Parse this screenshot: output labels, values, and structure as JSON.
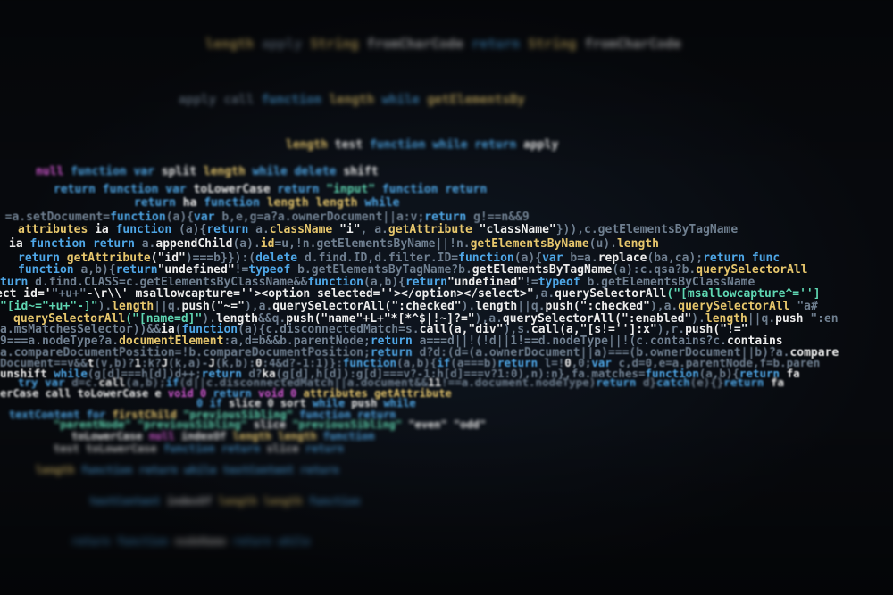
{
  "colors": {
    "b": "#4ea6e6",
    "y": "#e6c66c",
    "w": "#ececec",
    "g": "#5fd6b2",
    "d": "#6f7f90",
    "m": "#d65ad6",
    "t": "#34b6a6"
  },
  "lines": [
    [
      [
        "length ",
        "y"
      ],
      [
        "apply ",
        "d"
      ],
      [
        "String ",
        "y"
      ],
      [
        "fromCharCode ",
        "w"
      ],
      [
        "return ",
        "b"
      ],
      [
        "String ",
        "y"
      ],
      [
        "fromCharCode",
        "w"
      ]
    ],
    [
      [
        "apply ",
        "d"
      ],
      [
        "call ",
        "d"
      ],
      [
        "function ",
        "b"
      ],
      [
        "length ",
        "y"
      ],
      [
        "while ",
        "b"
      ],
      [
        "getElementsBy",
        "y"
      ]
    ],
    [
      [
        "length ",
        "y"
      ],
      [
        "test ",
        "w"
      ],
      [
        "function ",
        "b"
      ],
      [
        "while ",
        "b"
      ],
      [
        "return ",
        "b"
      ],
      [
        "apply",
        "w"
      ]
    ],
    [
      [
        "null ",
        "m"
      ],
      [
        "function ",
        "b"
      ],
      [
        "var ",
        "b"
      ],
      [
        "split ",
        "w"
      ],
      [
        "length ",
        "y"
      ],
      [
        "while ",
        "b"
      ],
      [
        "delete ",
        "b"
      ],
      [
        "shift",
        "w"
      ]
    ],
    [
      [
        "return ",
        "b"
      ],
      [
        "function ",
        "b"
      ],
      [
        "var ",
        "b"
      ],
      [
        "toLowerCase ",
        "w"
      ],
      [
        "return ",
        "b"
      ],
      [
        "\"input\" ",
        "g"
      ],
      [
        "function ",
        "b"
      ],
      [
        "return",
        "b"
      ]
    ],
    [
      [
        "return ",
        "b"
      ],
      [
        "ha ",
        "w"
      ],
      [
        "function ",
        "b"
      ],
      [
        "length ",
        "y"
      ],
      [
        "length ",
        "y"
      ],
      [
        "while",
        "b"
      ]
    ],
    [
      [
        "1 ",
        "b"
      ],
      [
        "=a.setDocument=",
        "d"
      ],
      [
        "function",
        "b"
      ],
      [
        "(a){",
        "d"
      ],
      [
        "var ",
        "b"
      ],
      [
        "b,e,g=a?a.ownerDocument||a:v;",
        "d"
      ],
      [
        "return ",
        "b"
      ],
      [
        "g!==n&&9",
        "d"
      ]
    ],
    [
      [
        "attributes ",
        "y"
      ],
      [
        "ia ",
        "w"
      ],
      [
        "function ",
        "b"
      ],
      [
        "(a){",
        "d"
      ],
      [
        "return ",
        "b"
      ],
      [
        "a.",
        "d"
      ],
      [
        "className ",
        "y"
      ],
      [
        "\"i\"",
        "w"
      ],
      [
        ", a.",
        "d"
      ],
      [
        "getAttribute ",
        "y"
      ],
      [
        "\"className\"",
        "w"
      ],
      [
        "})),c.getElementsByTagName",
        "d"
      ]
    ],
    [
      [
        "ia ",
        "w"
      ],
      [
        "function ",
        "b"
      ],
      [
        "return ",
        "b"
      ],
      [
        "a.",
        "d"
      ],
      [
        "appendChild",
        "w"
      ],
      [
        "(a).",
        "d"
      ],
      [
        "id",
        "y"
      ],
      [
        "=u,!n.getElementsByName||!n.",
        "d"
      ],
      [
        "getElementsByName",
        "y"
      ],
      [
        "(u).",
        "d"
      ],
      [
        "length",
        "y"
      ]
    ],
    [
      [
        "return ",
        "b"
      ],
      [
        "getAttribute",
        "y"
      ],
      [
        "(\"id\"",
        "w"
      ],
      [
        ")===b}}):(",
        "d"
      ],
      [
        "delete ",
        "b"
      ],
      [
        "d.find.ID,d.filter.ID=",
        "d"
      ],
      [
        "function",
        "b"
      ],
      [
        "(a){",
        "d"
      ],
      [
        "var ",
        "b"
      ],
      [
        "b=a.",
        "d"
      ],
      [
        "replace",
        "w"
      ],
      [
        "(ba,ca);",
        "d"
      ],
      [
        "return func",
        "b"
      ]
    ],
    [
      [
        "function ",
        "b"
      ],
      [
        "a,b){",
        "d"
      ],
      [
        "return",
        "b"
      ],
      [
        "\"undefined\"",
        "w"
      ],
      [
        "!=",
        "d"
      ],
      [
        "typeof ",
        "b"
      ],
      [
        "b.getElementsByTagName?b.",
        "d"
      ],
      [
        "getElementsByTagName",
        "w"
      ],
      [
        "(a):c.qsa?b.",
        "d"
      ],
      [
        "querySelectorAll",
        "y"
      ]
    ],
    [
      [
        "turn ",
        "b"
      ],
      [
        "d.find.CLASS=c.getElementsByClassName&&",
        "d"
      ],
      [
        "function",
        "b"
      ],
      [
        "(a,b){",
        "d"
      ],
      [
        "return",
        "b"
      ],
      [
        "\"undefined\"",
        "w"
      ],
      [
        "!=",
        "d"
      ],
      [
        "typeof ",
        "b"
      ],
      [
        "b.getElementsByClassName",
        "d"
      ]
    ],
    [
      [
        "ect id='",
        "w"
      ],
      [
        "\"+u+\"",
        "d"
      ],
      [
        "-\\r\\\\' msallowcapture=''><option selected=''></option></select>\"",
        "w"
      ],
      [
        ",a.",
        "d"
      ],
      [
        "querySelectorAll",
        "w"
      ],
      [
        "(\"[msallowcapture^='']",
        "g"
      ]
    ],
    [
      [
        "\"[id~=\"+u+\"-]\"",
        "g"
      ],
      [
        ").",
        "d"
      ],
      [
        "length",
        "y"
      ],
      [
        "||q.",
        "d"
      ],
      [
        "push",
        "w"
      ],
      [
        "(\"~=\"",
        "w"
      ],
      [
        "),a.",
        "d"
      ],
      [
        "querySelectorAll",
        "w"
      ],
      [
        "(\":checked\"",
        "w"
      ],
      [
        ").",
        "d"
      ],
      [
        "length",
        "w"
      ],
      [
        "||q.",
        "d"
      ],
      [
        "push",
        "w"
      ],
      [
        "(\":checked\"",
        "w"
      ],
      [
        "),a.",
        "d"
      ],
      [
        "querySelectorAll ",
        "y"
      ],
      [
        "\"a#",
        "d"
      ]
    ],
    [
      [
        "querySelectorAll",
        "y"
      ],
      [
        "(\"[name=d]\"",
        "g"
      ],
      [
        ").",
        "d"
      ],
      [
        "length",
        "w"
      ],
      [
        "&&q.",
        "d"
      ],
      [
        "push",
        "w"
      ],
      [
        "(\"name\"+L+\"*[*^$|!~]?=\"",
        "w"
      ],
      [
        "),a.",
        "d"
      ],
      [
        "querySelectorAll",
        "w"
      ],
      [
        "(\":enabled\"",
        "w"
      ],
      [
        ").",
        "d"
      ],
      [
        "length",
        "y"
      ],
      [
        "||q.",
        "d"
      ],
      [
        "push ",
        "w"
      ],
      [
        "\":en",
        "d"
      ]
    ],
    [
      [
        "a.msMatchesSelector))&&",
        "d"
      ],
      [
        "ia",
        "w"
      ],
      [
        "(",
        "d"
      ],
      [
        "function",
        "b"
      ],
      [
        "(a){c.disconnectedMatch=s.",
        "d"
      ],
      [
        "call",
        "w"
      ],
      [
        "(a,\"div\"",
        "w"
      ],
      [
        "),s.",
        "d"
      ],
      [
        "call",
        "w"
      ],
      [
        "(a,\"[s!='']:x\"",
        "w"
      ],
      [
        "),r.",
        "d"
      ],
      [
        "push",
        "w"
      ],
      [
        "(\"!=\"",
        "w"
      ]
    ],
    [
      [
        "9===a.nodeType?a.",
        "d"
      ],
      [
        "documentElement",
        "y"
      ],
      [
        ":a,d=b&&b.parentNode;",
        "d"
      ],
      [
        "return ",
        "b"
      ],
      [
        "a===d||!(!d||1!==d.nodeType||!(c.contains?c.",
        "d"
      ],
      [
        "contains",
        "w"
      ]
    ],
    [
      [
        "a.compareDocumentPosition=!b.compareDocumentPosition;",
        "d"
      ],
      [
        "return ",
        "b"
      ],
      [
        "d?d:(d=(a.ownerDocument||a)===(b.ownerDocument||b)?a.",
        "d"
      ],
      [
        "compare",
        "w"
      ]
    ],
    [
      [
        "Document==v&&",
        "d"
      ],
      [
        "t",
        "w"
      ],
      [
        "(v,b)?",
        "d"
      ],
      [
        "1",
        "w"
      ],
      [
        ":k?",
        "d"
      ],
      [
        "J",
        "w"
      ],
      [
        "(k,a)-",
        "d"
      ],
      [
        "J",
        "w"
      ],
      [
        "(k,b):",
        "d"
      ],
      [
        "0",
        "w"
      ],
      [
        ":4&d?-1:1)}:",
        "d"
      ],
      [
        "function",
        "b"
      ],
      [
        "(a,b){",
        "d"
      ],
      [
        "if",
        "b"
      ],
      [
        "(a===b)",
        "d"
      ],
      [
        "return ",
        "b"
      ],
      [
        "l=!",
        "d"
      ],
      [
        "0",
        "w"
      ],
      [
        ",0;",
        "d"
      ],
      [
        "var ",
        "b"
      ],
      [
        "c,d=0,e=a.parentNode,f=b.paren",
        "d"
      ]
    ],
    [
      [
        "unshift ",
        "w"
      ],
      [
        "while",
        "b"
      ],
      [
        "(g[d]===h[d])d++;",
        "d"
      ],
      [
        "return ",
        "b"
      ],
      [
        "d?",
        "d"
      ],
      [
        "ka",
        "w"
      ],
      [
        "(g[d],h[d]):g[d]===v?-1:h[d]===v?1:0),n):n},fa.matches=",
        "d"
      ],
      [
        "function",
        "b"
      ],
      [
        "(a,b){",
        "d"
      ],
      [
        "return ",
        "b"
      ],
      [
        "fa",
        "w"
      ]
    ],
    [
      [
        "try var ",
        "b"
      ],
      [
        "d=c.",
        "d"
      ],
      [
        "call",
        "w"
      ],
      [
        "(a,b);",
        "d"
      ],
      [
        "if",
        "b"
      ],
      [
        "(d||c.disconnectedMatch||a.document&&",
        "d"
      ],
      [
        "11",
        "w"
      ],
      [
        "!==a.document.nodeType)",
        "d"
      ],
      [
        "return ",
        "b"
      ],
      [
        "d}",
        "d"
      ],
      [
        "catch",
        "b"
      ],
      [
        "(e){}",
        "d"
      ],
      [
        "return ",
        "b"
      ],
      [
        "fa",
        "w"
      ]
    ],
    [
      [
        "erCase ",
        "w"
      ],
      [
        "call ",
        "w"
      ],
      [
        "toLowerCase ",
        "w"
      ],
      [
        "e ",
        "w"
      ],
      [
        "void 0 ",
        "m"
      ],
      [
        "return ",
        "b"
      ],
      [
        "void 0 ",
        "m"
      ],
      [
        "attributes ",
        "y"
      ],
      [
        "getAttribute",
        "y"
      ]
    ],
    [
      [
        "0 if ",
        "b"
      ],
      [
        "slice 0 ",
        "w"
      ],
      [
        "sort ",
        "w"
      ],
      [
        "while ",
        "b"
      ],
      [
        "push ",
        "w"
      ],
      [
        "while",
        "b"
      ]
    ],
    [
      [
        "textContent ",
        "b"
      ],
      [
        "for ",
        "b"
      ],
      [
        "firstChild ",
        "y"
      ],
      [
        "\"previousSibling\" ",
        "g"
      ],
      [
        "function ",
        "b"
      ],
      [
        "return",
        "b"
      ]
    ],
    [
      [
        "\"parentNode\" ",
        "g"
      ],
      [
        "\"previousSibling\" ",
        "g"
      ],
      [
        "slice ",
        "w"
      ],
      [
        "\"previousSibling\" ",
        "g"
      ],
      [
        "\"even\" ",
        "w"
      ],
      [
        "\"odd\"",
        "w"
      ]
    ],
    [
      [
        "toLowerCase ",
        "w"
      ],
      [
        "null ",
        "m"
      ],
      [
        "indexOf ",
        "w"
      ],
      [
        "length ",
        "y"
      ],
      [
        "length ",
        "y"
      ],
      [
        "function",
        "b"
      ]
    ],
    [
      [
        "test ",
        "w"
      ],
      [
        "toLowerCase ",
        "w"
      ],
      [
        "function ",
        "b"
      ],
      [
        "return ",
        "b"
      ],
      [
        "slice ",
        "w"
      ],
      [
        "return",
        "b"
      ]
    ],
    [
      [
        "length ",
        "y"
      ],
      [
        "function ",
        "b"
      ],
      [
        "return ",
        "b"
      ],
      [
        "while ",
        "b"
      ],
      [
        "textContent ",
        "b"
      ],
      [
        "return",
        "b"
      ]
    ],
    [
      [
        "textContent ",
        "b"
      ],
      [
        "indexOf ",
        "w"
      ],
      [
        "length ",
        "y"
      ],
      [
        "length ",
        "y"
      ],
      [
        "function",
        "b"
      ]
    ],
    [
      [
        "return ",
        "b"
      ],
      [
        "function ",
        "b"
      ],
      [
        "nodeName ",
        "w"
      ],
      [
        "return ",
        "b"
      ],
      [
        "while",
        "b"
      ]
    ]
  ]
}
